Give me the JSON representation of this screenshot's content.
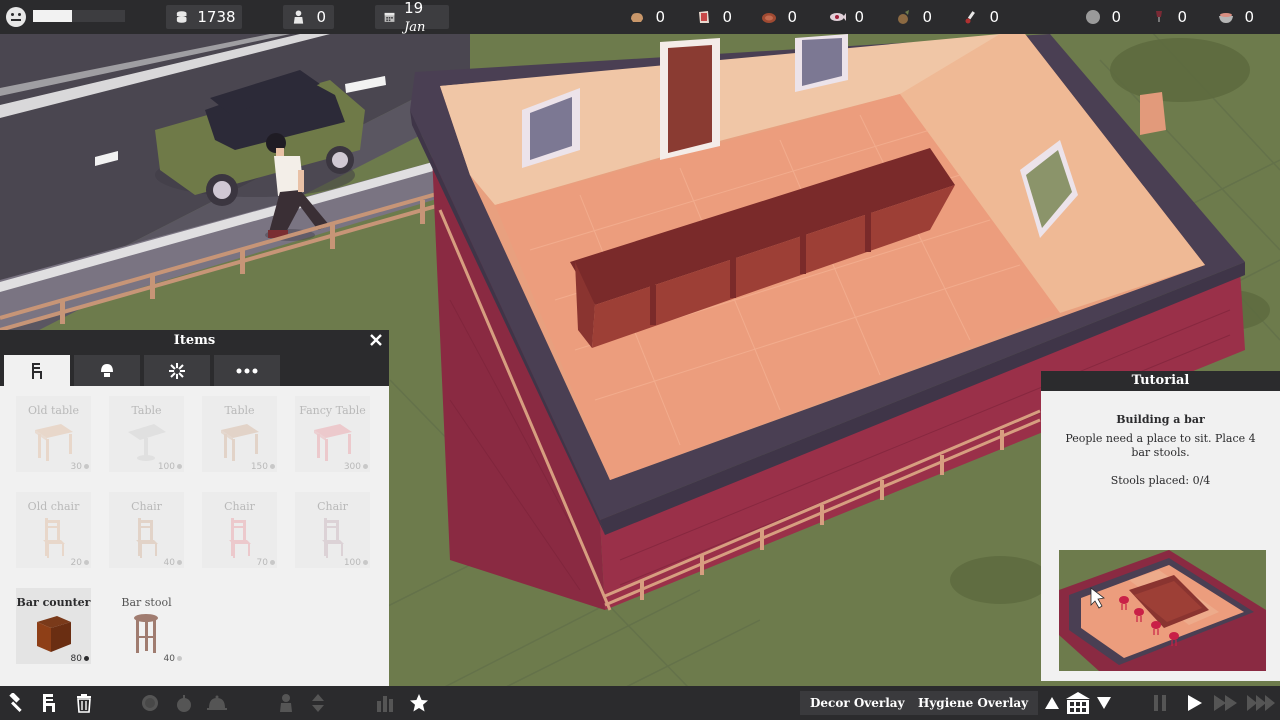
{
  "topbar": {
    "mood_level": 0.42,
    "money": "1738",
    "guests": "0",
    "date_day": "19",
    "date_month": "Jan",
    "resources_left": [
      {
        "icon": "bread-icon",
        "value": "0"
      },
      {
        "icon": "cheese-icon",
        "value": "0"
      },
      {
        "icon": "meat-icon",
        "value": "0"
      },
      {
        "icon": "fish-icon",
        "value": "0"
      },
      {
        "icon": "vegetable-icon",
        "value": "0"
      },
      {
        "icon": "spice-icon",
        "value": "0"
      }
    ],
    "resources_right": [
      {
        "icon": "coin-icon",
        "value": "0"
      },
      {
        "icon": "wine-icon",
        "value": "0"
      },
      {
        "icon": "bowl-icon",
        "value": "0"
      }
    ]
  },
  "items_panel": {
    "title": "Items",
    "tabs": [
      {
        "icon": "chair-icon",
        "active": true
      },
      {
        "icon": "lamp-icon",
        "active": false
      },
      {
        "icon": "decoration-icon",
        "active": false
      },
      {
        "icon": "more-icon",
        "active": false
      }
    ],
    "items": [
      {
        "name": "Old table",
        "price": "30",
        "state": "locked"
      },
      {
        "name": "Table",
        "price": "100",
        "state": "locked"
      },
      {
        "name": "Table",
        "price": "150",
        "state": "locked"
      },
      {
        "name": "Fancy Table",
        "price": "300",
        "state": "locked"
      },
      {
        "name": "Old chair",
        "price": "20",
        "state": "locked"
      },
      {
        "name": "Chair",
        "price": "40",
        "state": "locked"
      },
      {
        "name": "Chair",
        "price": "70",
        "state": "locked"
      },
      {
        "name": "Chair",
        "price": "100",
        "state": "locked"
      },
      {
        "name": "Bar counter",
        "price": "80",
        "state": "selected"
      },
      {
        "name": "Bar stool",
        "price": "40",
        "state": "available"
      }
    ]
  },
  "tutorial": {
    "header": "Tutorial",
    "title": "Building a bar",
    "body": "People need a place to sit. Place 4 bar stools.",
    "progress_text": "Stools placed: 0/4"
  },
  "bottombar": {
    "decor_overlay": "Decor Overlay",
    "hygiene_overlay": "Hygiene Overlay"
  },
  "colors": {
    "bar_bg": "#2b2b2d",
    "panel_bg": "#f1f1f1",
    "wall": "#8a2a42",
    "floor": "#e59b7a",
    "grass": "#6b7a4a"
  }
}
